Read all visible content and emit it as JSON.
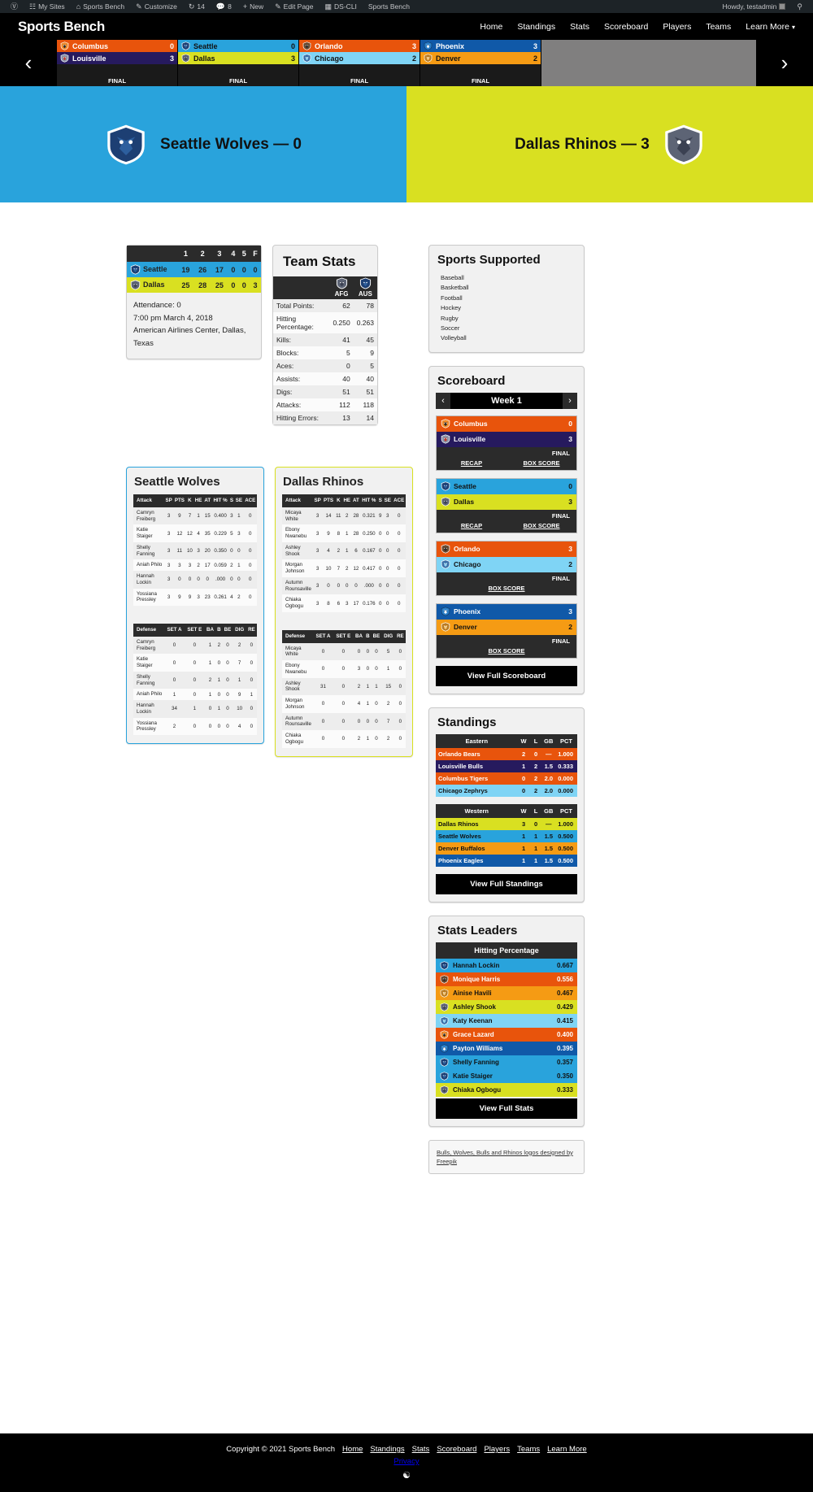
{
  "adminbar": {
    "items": [
      {
        "icon": "wordpress-icon",
        "label": ""
      },
      {
        "icon": "sites-icon",
        "label": "My Sites"
      },
      {
        "icon": "home-icon",
        "label": "Sports Bench"
      },
      {
        "icon": "pencil-icon",
        "label": "Customize"
      },
      {
        "icon": "updates-icon",
        "label": "14"
      },
      {
        "icon": "comment-icon",
        "label": "8"
      },
      {
        "icon": "plus-icon",
        "label": "New"
      },
      {
        "icon": "edit-icon",
        "label": "Edit Page"
      },
      {
        "icon": "terminal-icon",
        "label": "DS-CLI"
      },
      {
        "icon": "",
        "label": "Sports Bench"
      }
    ],
    "howdy": "Howdy, testadmin",
    "search_icon": "search-icon"
  },
  "header": {
    "site_title": "Sports Bench",
    "nav": [
      "Home",
      "Standings",
      "Stats",
      "Scoreboard",
      "Players",
      "Teams"
    ],
    "nav_more": "Learn More"
  },
  "ticker": {
    "prev": "‹",
    "next": "›",
    "final": "FINAL",
    "games": [
      {
        "away": {
          "name": "Columbus",
          "score": "0",
          "bg": "#e8540c",
          "fg": "#ffffff",
          "logo": "tiger-icon",
          "logobg": "#ffffff"
        },
        "home": {
          "name": "Louisville",
          "score": "3",
          "bg": "#261a5e",
          "fg": "#ffffff",
          "logo": "bull-icon",
          "logobg": "#261a5e"
        }
      },
      {
        "away": {
          "name": "Seattle",
          "score": "0",
          "bg": "#29a3dc",
          "fg": "#111111",
          "logo": "wolf-icon",
          "logobg": "#29a3dc"
        },
        "home": {
          "name": "Dallas",
          "score": "3",
          "bg": "#d9e021",
          "fg": "#111111",
          "logo": "rhino-icon",
          "logobg": "#d9e021"
        }
      },
      {
        "away": {
          "name": "Orlando",
          "score": "3",
          "bg": "#e8540c",
          "fg": "#ffffff",
          "logo": "bear-icon",
          "logobg": "#e8540c"
        },
        "home": {
          "name": "Chicago",
          "score": "2",
          "bg": "#7fd4f5",
          "fg": "#111111",
          "logo": "zephyr-icon",
          "logobg": "#7fd4f5"
        }
      },
      {
        "away": {
          "name": "Phoenix",
          "score": "3",
          "bg": "#1059a8",
          "fg": "#ffffff",
          "logo": "eagle-icon",
          "logobg": "#1059a8"
        },
        "home": {
          "name": "Denver",
          "score": "2",
          "bg": "#f59b14",
          "fg": "#111111",
          "logo": "buffalo-icon",
          "logobg": "#f59b14"
        }
      }
    ]
  },
  "hero": {
    "away": {
      "text": "Seattle Wolves — 0",
      "bg": "#29a3dc",
      "logo": "wolf-icon"
    },
    "home": {
      "text": "Dallas Rhinos — 3",
      "bg": "#d9e021",
      "logo": "rhino-icon"
    }
  },
  "boxscore": {
    "headers": [
      "",
      "1",
      "2",
      "3",
      "4",
      "5",
      "F"
    ],
    "rows": [
      {
        "team": "Seattle",
        "logo": "wolf-icon",
        "bg": "#29a3dc",
        "cells": [
          "19",
          "26",
          "17",
          "0",
          "0",
          "0"
        ]
      },
      {
        "team": "Dallas",
        "logo": "rhino-icon",
        "bg": "#d9e021",
        "cells": [
          "25",
          "28",
          "25",
          "0",
          "0",
          "3"
        ]
      }
    ],
    "attendance": "Attendance: 0",
    "datetime": "7:00 pm March 4, 2018",
    "venue": "American Airlines Center, Dallas, Texas"
  },
  "team_stats": {
    "title": "Team Stats",
    "col_away": "AFG",
    "col_home": "AUS",
    "away_logo": "rhino-icon",
    "home_logo": "wolf-icon",
    "rows": [
      {
        "label": "Total Points:",
        "away": "62",
        "home": "78"
      },
      {
        "label": "Hitting Percentage:",
        "away": "0.250",
        "home": "0.263"
      },
      {
        "label": "Kills:",
        "away": "41",
        "home": "45"
      },
      {
        "label": "Blocks:",
        "away": "5",
        "home": "9"
      },
      {
        "label": "Aces:",
        "away": "0",
        "home": "5"
      },
      {
        "label": "Assists:",
        "away": "40",
        "home": "40"
      },
      {
        "label": "Digs:",
        "away": "51",
        "home": "51"
      },
      {
        "label": "Attacks:",
        "away": "112",
        "home": "118"
      },
      {
        "label": "Hitting Errors:",
        "away": "13",
        "home": "14"
      }
    ]
  },
  "teams_panels": [
    {
      "title": "Seattle Wolves",
      "border": "#29a3dc",
      "attack_headers": [
        "Attack",
        "SP",
        "PTS",
        "K",
        "HE",
        "AT",
        "HIT %",
        "S",
        "SE",
        "ACE"
      ],
      "attack_rows": [
        [
          "Camryn Freiberg",
          "3",
          "9",
          "7",
          "1",
          "15",
          "0.400",
          "3",
          "1",
          "0"
        ],
        [
          "Katie Staiger",
          "3",
          "12",
          "12",
          "4",
          "35",
          "0.229",
          "5",
          "3",
          "0"
        ],
        [
          "Shelly Fanning",
          "3",
          "11",
          "10",
          "3",
          "20",
          "0.350",
          "0",
          "0",
          "0"
        ],
        [
          "Aniah Philo",
          "3",
          "3",
          "3",
          "2",
          "17",
          "0.059",
          "2",
          "1",
          "0"
        ],
        [
          "Hannah Lockin",
          "3",
          "0",
          "0",
          "0",
          "0",
          ".000",
          "0",
          "0",
          "0"
        ],
        [
          "Yossiana Pressley",
          "3",
          "9",
          "9",
          "3",
          "23",
          "0.261",
          "4",
          "2",
          "0"
        ]
      ],
      "defense_headers": [
        "Defense",
        "SET A",
        "SET E",
        "BA",
        "B",
        "BE",
        "DIG",
        "RE"
      ],
      "defense_rows": [
        [
          "Camryn Freiberg",
          "0",
          "0",
          "1",
          "2",
          "0",
          "2",
          "0"
        ],
        [
          "Katie Staiger",
          "0",
          "0",
          "1",
          "0",
          "0",
          "7",
          "0"
        ],
        [
          "Shelly Fanning",
          "0",
          "0",
          "2",
          "1",
          "0",
          "1",
          "0"
        ],
        [
          "Aniah Philo",
          "1",
          "0",
          "1",
          "0",
          "0",
          "9",
          "1"
        ],
        [
          "Hannah Lockin",
          "34",
          "1",
          "0",
          "1",
          "0",
          "10",
          "0"
        ],
        [
          "Yossiana Pressley",
          "2",
          "0",
          "0",
          "0",
          "0",
          "4",
          "0"
        ]
      ]
    },
    {
      "title": "Dallas Rhinos",
      "border": "#d9e021",
      "attack_headers": [
        "Attack",
        "SP",
        "PTS",
        "K",
        "HE",
        "AT",
        "HIT %",
        "S",
        "SE",
        "ACE"
      ],
      "attack_rows": [
        [
          "Micaya White",
          "3",
          "14",
          "11",
          "2",
          "28",
          "0.321",
          "9",
          "3",
          "0"
        ],
        [
          "Ebony Nwanebu",
          "3",
          "9",
          "8",
          "1",
          "28",
          "0.250",
          "0",
          "0",
          "0"
        ],
        [
          "Ashley Shook",
          "3",
          "4",
          "2",
          "1",
          "6",
          "0.167",
          "0",
          "0",
          "0"
        ],
        [
          "Morgan Johnson",
          "3",
          "10",
          "7",
          "2",
          "12",
          "0.417",
          "0",
          "0",
          "0"
        ],
        [
          "Autumn Rounsaville",
          "3",
          "0",
          "0",
          "0",
          "0",
          ".000",
          "0",
          "0",
          "0"
        ],
        [
          "Chiaka Ogbogu",
          "3",
          "8",
          "6",
          "3",
          "17",
          "0.176",
          "0",
          "0",
          "0"
        ]
      ],
      "defense_headers": [
        "Defense",
        "SET A",
        "SET E",
        "BA",
        "B",
        "BE",
        "DIG",
        "RE"
      ],
      "defense_rows": [
        [
          "Micaya White",
          "0",
          "0",
          "0",
          "0",
          "0",
          "5",
          "0"
        ],
        [
          "Ebony Nwanebu",
          "0",
          "0",
          "3",
          "0",
          "0",
          "1",
          "0"
        ],
        [
          "Ashley Shook",
          "31",
          "0",
          "2",
          "1",
          "1",
          "15",
          "0"
        ],
        [
          "Morgan Johnson",
          "0",
          "0",
          "4",
          "1",
          "0",
          "2",
          "0"
        ],
        [
          "Autumn Rounsaville",
          "0",
          "0",
          "0",
          "0",
          "0",
          "7",
          "0"
        ],
        [
          "Chiaka Ogbogu",
          "0",
          "0",
          "2",
          "1",
          "0",
          "2",
          "0"
        ]
      ]
    }
  ],
  "sports_supported": {
    "title": "Sports Supported",
    "items": [
      "Baseball",
      "Basketball",
      "Football",
      "Hockey",
      "Rugby",
      "Soccer",
      "Volleyball"
    ]
  },
  "scoreboard_widget": {
    "title": "Scoreboard",
    "prev": "‹",
    "next": "›",
    "week": "Week 1",
    "final": "FINAL",
    "recap": "RECAP",
    "boxscore": "BOX SCORE",
    "view_full": "View Full Scoreboard",
    "games": [
      {
        "away": {
          "name": "Columbus",
          "score": "0",
          "bg": "#e8540c",
          "fg": "#ffffff",
          "logo": "tiger-icon"
        },
        "home": {
          "name": "Louisville",
          "score": "3",
          "bg": "#261a5e",
          "fg": "#ffffff",
          "logo": "bull-icon"
        },
        "has_recap": true
      },
      {
        "away": {
          "name": "Seattle",
          "score": "0",
          "bg": "#29a3dc",
          "fg": "#111111",
          "logo": "wolf-icon"
        },
        "home": {
          "name": "Dallas",
          "score": "3",
          "bg": "#d9e021",
          "fg": "#111111",
          "logo": "rhino-icon"
        },
        "has_recap": true
      },
      {
        "away": {
          "name": "Orlando",
          "score": "3",
          "bg": "#e8540c",
          "fg": "#ffffff",
          "logo": "bear-icon"
        },
        "home": {
          "name": "Chicago",
          "score": "2",
          "bg": "#7fd4f5",
          "fg": "#111111",
          "logo": "zephyr-icon"
        },
        "has_recap": false
      },
      {
        "away": {
          "name": "Phoenix",
          "score": "3",
          "bg": "#1059a8",
          "fg": "#ffffff",
          "logo": "eagle-icon"
        },
        "home": {
          "name": "Denver",
          "score": "2",
          "bg": "#f59b14",
          "fg": "#111111",
          "logo": "buffalo-icon"
        },
        "has_recap": false
      }
    ]
  },
  "standings_widget": {
    "title": "Standings",
    "view_full": "View Full Standings",
    "columns": [
      "W",
      "L",
      "GB",
      "PCT"
    ],
    "divisions": [
      {
        "name": "Eastern",
        "rows": [
          {
            "team": "Orlando Bears",
            "bg": "#e8540c",
            "fg": "#ffffff",
            "w": "2",
            "l": "0",
            "gb": "—",
            "pct": "1.000"
          },
          {
            "team": "Louisville Bulls",
            "bg": "#261a5e",
            "fg": "#ffffff",
            "w": "1",
            "l": "2",
            "gb": "1.5",
            "pct": "0.333"
          },
          {
            "team": "Columbus Tigers",
            "bg": "#e8540c",
            "fg": "#ffffff",
            "w": "0",
            "l": "2",
            "gb": "2.0",
            "pct": "0.000"
          },
          {
            "team": "Chicago Zephrys",
            "bg": "#7fd4f5",
            "fg": "#111111",
            "w": "0",
            "l": "2",
            "gb": "2.0",
            "pct": "0.000"
          }
        ]
      },
      {
        "name": "Western",
        "rows": [
          {
            "team": "Dallas Rhinos",
            "bg": "#d9e021",
            "fg": "#111111",
            "w": "3",
            "l": "0",
            "gb": "—",
            "pct": "1.000"
          },
          {
            "team": "Seattle Wolves",
            "bg": "#29a3dc",
            "fg": "#111111",
            "w": "1",
            "l": "1",
            "gb": "1.5",
            "pct": "0.500"
          },
          {
            "team": "Denver Buffalos",
            "bg": "#f59b14",
            "fg": "#111111",
            "w": "1",
            "l": "1",
            "gb": "1.5",
            "pct": "0.500"
          },
          {
            "team": "Phoenix Eagles",
            "bg": "#1059a8",
            "fg": "#ffffff",
            "w": "1",
            "l": "1",
            "gb": "1.5",
            "pct": "0.500"
          }
        ]
      }
    ]
  },
  "stats_leaders": {
    "title": "Stats Leaders",
    "category": "Hitting Percentage",
    "view_full": "View Full Stats",
    "rows": [
      {
        "name": "Hannah Lockin",
        "value": "0.667",
        "bg": "#29a3dc",
        "fg": "#111111",
        "logo": "wolf-icon"
      },
      {
        "name": "Monique Harris",
        "value": "0.556",
        "bg": "#e8540c",
        "fg": "#ffffff",
        "logo": "bear-icon"
      },
      {
        "name": "Ainise Havili",
        "value": "0.467",
        "bg": "#f59b14",
        "fg": "#111111",
        "logo": "buffalo-icon"
      },
      {
        "name": "Ashley Shook",
        "value": "0.429",
        "bg": "#d9e021",
        "fg": "#111111",
        "logo": "rhino-icon"
      },
      {
        "name": "Katy Keenan",
        "value": "0.415",
        "bg": "#7fd4f5",
        "fg": "#111111",
        "logo": "zephyr-icon"
      },
      {
        "name": "Grace Lazard",
        "value": "0.400",
        "bg": "#e8540c",
        "fg": "#ffffff",
        "logo": "tiger-icon"
      },
      {
        "name": "Payton Williams",
        "value": "0.395",
        "bg": "#1059a8",
        "fg": "#ffffff",
        "logo": "eagle-icon"
      },
      {
        "name": "Shelly Fanning",
        "value": "0.357",
        "bg": "#29a3dc",
        "fg": "#111111",
        "logo": "wolf-icon"
      },
      {
        "name": "Katie Staiger",
        "value": "0.350",
        "bg": "#29a3dc",
        "fg": "#111111",
        "logo": "wolf-icon"
      },
      {
        "name": "Chiaka Ogbogu",
        "value": "0.333",
        "bg": "#d9e021",
        "fg": "#111111",
        "logo": "rhino-icon"
      }
    ]
  },
  "credit": {
    "text": "Bulls, Wolves, Bulls and Rhinos logos designed by Freepik"
  },
  "footer": {
    "copyright": "Copyright © 2021 Sports Bench",
    "links": [
      "Home",
      "Standings",
      "Stats",
      "Scoreboard",
      "Players",
      "Teams",
      "Learn More"
    ],
    "privacy": "Privacy",
    "rss_icon": "rss-icon"
  }
}
